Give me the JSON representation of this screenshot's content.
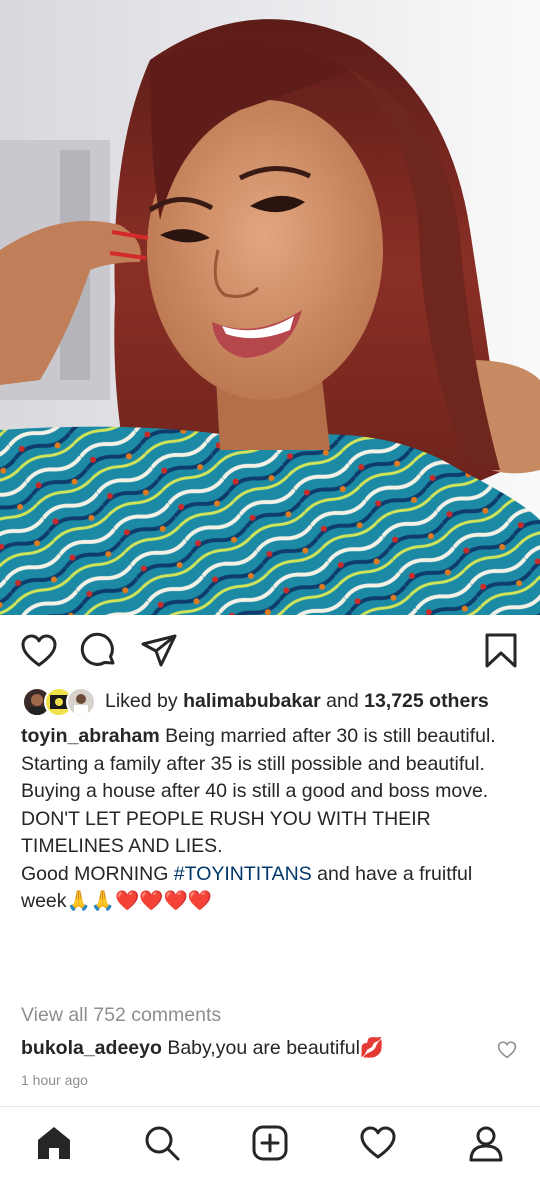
{
  "post": {
    "image_alt": "Woman with auburn shoulder-length hair smiling, wearing a colorful patterned outfit",
    "likes": {
      "prefix": "Liked by",
      "liker": "halimabubakar",
      "connector": "and",
      "others": "13,725 others"
    },
    "caption": {
      "username": "toyin_abraham",
      "lines": [
        "Being married after 30 is still beautiful.",
        "Starting a family after 35 is still possible and beautiful.",
        "Buying a house after 40 is still a good and boss move.",
        "DON'T LET PEOPLE RUSH YOU WITH THEIR TIMELINES AND LIES."
      ],
      "last_line_prefix": "Good MORNING ",
      "hashtag": "#TOYINTITANS",
      "last_line_suffix": " and  have a fruitful week🙏🙏❤️❤️❤️❤️"
    },
    "view_comments": "View all 752 comments",
    "comment": {
      "username": "bukola_adeeyo",
      "text": "Baby,you are beautiful💋"
    },
    "timestamp": "1 hour ago"
  },
  "icons": {
    "like": "heart-icon",
    "comment": "comment-bubble-icon",
    "share": "paper-plane-icon",
    "save": "bookmark-icon"
  },
  "nav": [
    "home-icon",
    "search-icon",
    "add-post-icon",
    "activity-heart-icon",
    "profile-icon"
  ],
  "colors": {
    "text": "#262626",
    "muted": "#8e8e8e",
    "hashtag": "#00376b",
    "hair": "#7a2a22",
    "background": "#ffffff"
  }
}
